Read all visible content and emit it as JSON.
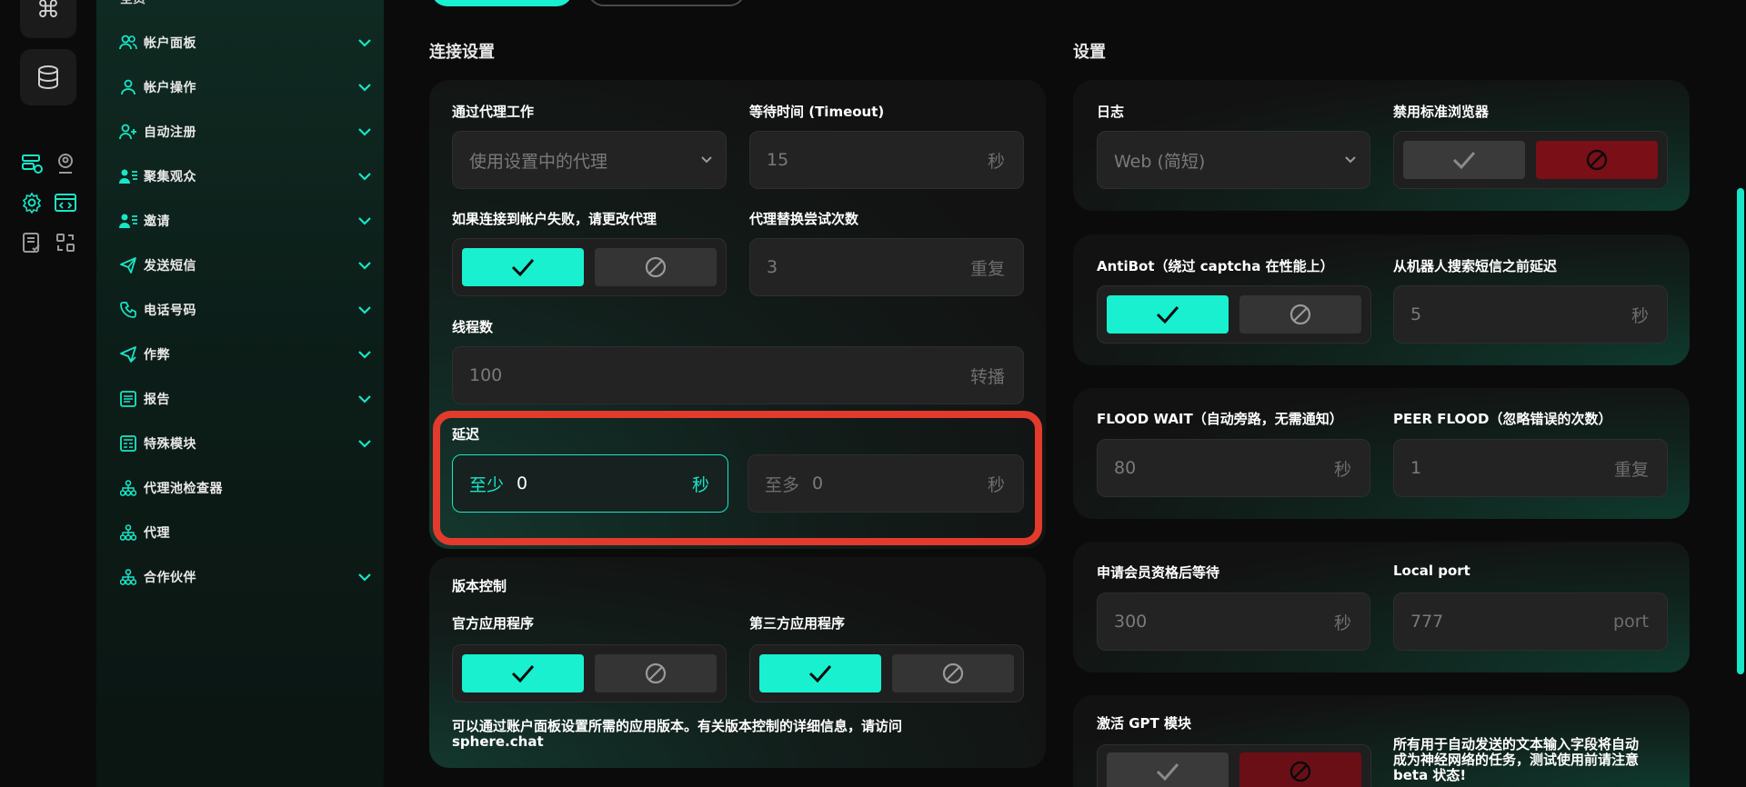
{
  "sidebar": {
    "top_label": "全员",
    "items": [
      {
        "label": "帐户面板",
        "icon": "users-icon",
        "expandable": true
      },
      {
        "label": "帐户操作",
        "icon": "user-icon",
        "expandable": true
      },
      {
        "label": "自动注册",
        "icon": "user-plus-icon",
        "expandable": true
      },
      {
        "label": "聚集观众",
        "icon": "user-list-icon",
        "expandable": true
      },
      {
        "label": "邀请",
        "icon": "user-list-icon",
        "expandable": true
      },
      {
        "label": "发送短信",
        "icon": "send-icon",
        "expandable": true
      },
      {
        "label": "电话号码",
        "icon": "phone-icon",
        "expandable": true
      },
      {
        "label": "作弊",
        "icon": "send-check-icon",
        "expandable": true
      },
      {
        "label": "报告",
        "icon": "report-icon",
        "expandable": true
      },
      {
        "label": "特殊模块",
        "icon": "module-icon",
        "expandable": true
      },
      {
        "label": "代理池检查器",
        "icon": "network-icon",
        "expandable": false
      },
      {
        "label": "代理",
        "icon": "network-icon",
        "expandable": false
      },
      {
        "label": "合作伙伴",
        "icon": "network-icon",
        "expandable": true
      }
    ]
  },
  "connection": {
    "title": "连接设置",
    "proxy_work_label": "通过代理工作",
    "proxy_work_value": "使用设置中的代理",
    "timeout_label": "等待时间 (Timeout)",
    "timeout_value": "15",
    "timeout_unit": "秒",
    "change_proxy_label": "如果连接到帐户失败，请更改代理",
    "change_proxy_enabled": true,
    "proxy_attempts_label": "代理替换尝试次数",
    "proxy_attempts_value": "3",
    "proxy_attempts_unit": "重复",
    "threads_label": "线程数",
    "threads_value": "100",
    "threads_unit": "转播",
    "delay_label": "延迟",
    "delay_min_prefix": "至少",
    "delay_min_value": "0",
    "delay_min_unit": "秒",
    "delay_max_prefix": "至多",
    "delay_max_value": "0",
    "delay_max_unit": "秒"
  },
  "version": {
    "title": "版本控制",
    "official_label": "官方应用程序",
    "official_enabled": true,
    "third_party_label": "第三方应用程序",
    "third_party_enabled": true,
    "note_line1": "可以通过账户面板设置所需的应用版本。有关版本控制的详细信息，请访问",
    "note_line2": "sphere.chat"
  },
  "settings": {
    "title": "设置",
    "log_label": "日志",
    "log_value": "Web (简短)",
    "disable_browser_label": "禁用标准浏览器",
    "disable_browser_enabled": false,
    "antibot_label": "AntiBot（绕过 captcha 在性能上）",
    "antibot_enabled": true,
    "bot_delay_label": "从机器人搜索短信之前延迟",
    "bot_delay_value": "5",
    "bot_delay_unit": "秒",
    "flood_wait_label": "FLOOD WAIT（自动旁路，无需通知）",
    "flood_wait_value": "80",
    "flood_wait_unit": "秒",
    "peer_flood_label": "PEER FLOOD（忽略错误的次数）",
    "peer_flood_value": "1",
    "peer_flood_unit": "重复",
    "membership_wait_label": "申请会员资格后等待",
    "membership_wait_value": "300",
    "membership_wait_unit": "秒",
    "local_port_label": "Local port",
    "local_port_value": "777",
    "local_port_unit": "port",
    "gpt_label": "激活 GPT 模块",
    "gpt_enabled": false,
    "gpt_note_1": "所有用于自动发送的文本输入字段将自动",
    "gpt_note_2": "成为神经网络的任务，测试使用前请注意",
    "gpt_note_3": "beta 状态!"
  },
  "colors": {
    "accent": "#18f0cf",
    "highlight": "#e23a2c",
    "disabled_red": "#6b0f17"
  }
}
